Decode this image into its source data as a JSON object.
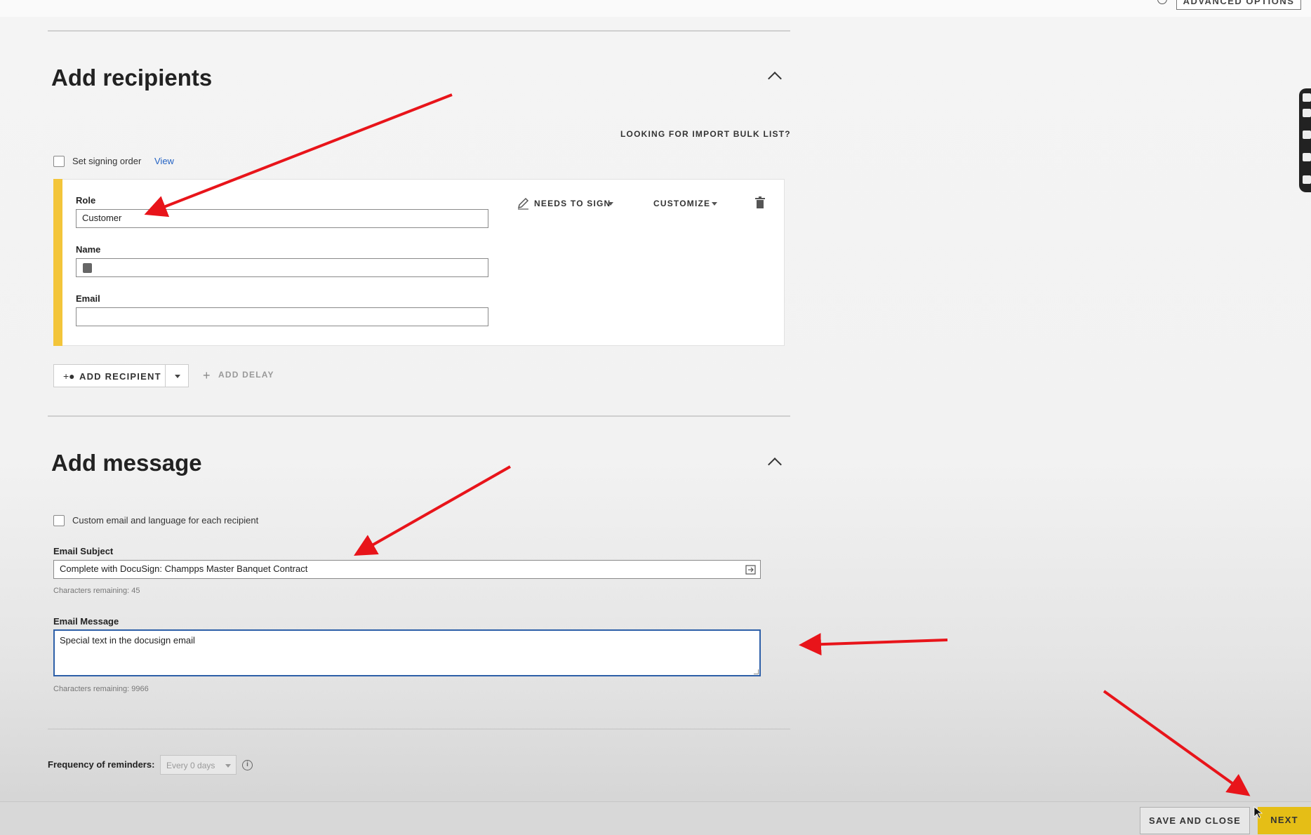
{
  "header": {
    "advanced_options_label": "ADVANCED OPTIONS"
  },
  "recipients": {
    "title": "Add recipients",
    "import_bulk_link": "LOOKING FOR IMPORT BULK LIST?",
    "signing_order_label": "Set signing order",
    "view_link": "View",
    "recipient": {
      "role_label": "Role",
      "role_value": "Customer",
      "name_label": "Name",
      "name_value": "",
      "email_label": "Email",
      "email_value": "",
      "action_label": "NEEDS TO SIGN",
      "customize_label": "CUSTOMIZE"
    },
    "add_recipient_label": "ADD RECIPIENT",
    "add_delay_label": "ADD DELAY"
  },
  "message": {
    "title": "Add message",
    "custom_email_label": "Custom email and language for each recipient",
    "subject_label": "Email Subject",
    "subject_value": "Complete with DocuSign: Champps Master Banquet Contract",
    "subject_remaining": "Characters remaining: 45",
    "message_label": "Email Message",
    "message_value": "Special text in the docusign email",
    "message_remaining": "Characters remaining: 9966"
  },
  "reminders": {
    "label": "Frequency of reminders:",
    "value": "Every 0 days"
  },
  "footer": {
    "save_close_label": "SAVE AND CLOSE",
    "next_label": "NEXT"
  },
  "colors": {
    "accent_yellow": "#f3c53a",
    "next_button": "#e5be16",
    "link_blue": "#2463c4",
    "focus_blue": "#2d5fa8",
    "annotation_red": "#e8141a"
  }
}
